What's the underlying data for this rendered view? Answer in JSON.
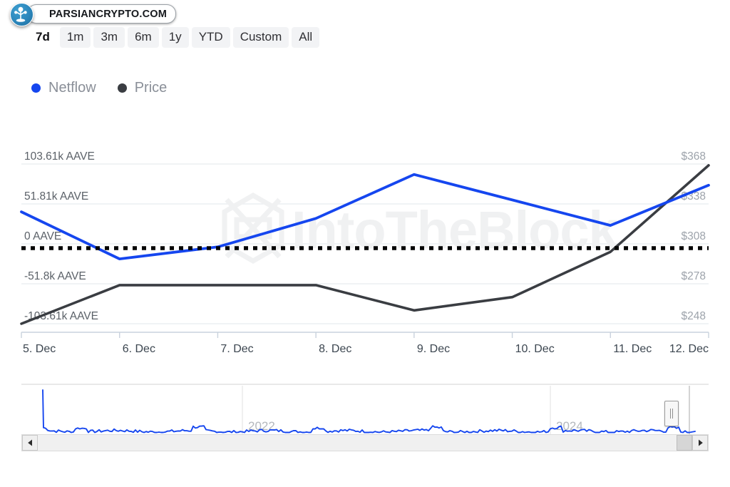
{
  "brand": {
    "watermark_label": "PARSIANCRYPTO.COM",
    "logo_icon": "parsiancrypto-circle-icon",
    "chart_watermark": "IntoTheBlock",
    "chart_watermark_icon": "intotheblock-cube-icon"
  },
  "range_tabs": {
    "items": [
      {
        "label": "7d",
        "selected": true
      },
      {
        "label": "1m",
        "selected": false
      },
      {
        "label": "3m",
        "selected": false
      },
      {
        "label": "6m",
        "selected": false
      },
      {
        "label": "1y",
        "selected": false
      },
      {
        "label": "YTD",
        "selected": false
      },
      {
        "label": "Custom",
        "selected": false
      },
      {
        "label": "All",
        "selected": false
      }
    ]
  },
  "legend": {
    "items": [
      {
        "label": "Netflow",
        "color": "#1546ef",
        "icon": "legend-dot-icon"
      },
      {
        "label": "Price",
        "color": "#3a3d42",
        "icon": "legend-dot-icon"
      }
    ]
  },
  "navigator": {
    "year_labels": [
      "2022",
      "2024"
    ],
    "left_arrow_icon": "triangle-left-icon",
    "right_arrow_icon": "triangle-right-icon",
    "handle_icon": "drag-handle-icon",
    "series_color": "#1546ef"
  },
  "chart_data": {
    "type": "line",
    "title": "",
    "subtitle": "",
    "xlabel": "",
    "grid": true,
    "legend_position": "top-left",
    "zero_line": {
      "value": 0,
      "style": "dotted",
      "color": "#000000"
    },
    "categories": [
      "5. Dec",
      "6. Dec",
      "7. Dec",
      "8. Dec",
      "9. Dec",
      "10. Dec",
      "11. Dec",
      "12. Dec"
    ],
    "x_tick_labels": [
      "5. Dec",
      "6. Dec",
      "7. Dec",
      "8. Dec",
      "9. Dec",
      "10. Dec",
      "11. Dec",
      "12. Dec"
    ],
    "axes": {
      "left": {
        "name": "Netflow",
        "unit": "AAVE",
        "tick_labels": [
          "103.61k AAVE",
          "51.81k AAVE",
          "0 AAVE",
          "-51.8k AAVE",
          "-103.61k AAVE"
        ],
        "tick_values": [
          103610,
          51810,
          0,
          -51800,
          -103610
        ],
        "ylim": [
          -103610,
          103610
        ]
      },
      "right": {
        "name": "Price",
        "unit": "USD",
        "tick_labels": [
          "$368",
          "$338",
          "$308",
          "$278",
          "$248"
        ],
        "tick_values": [
          368,
          338,
          308,
          278,
          248
        ],
        "ylim": [
          248,
          368
        ]
      }
    },
    "series": [
      {
        "name": "Netflow",
        "axis": "left",
        "color": "#1546ef",
        "unit": "AAVE",
        "values": [
          41500,
          -19500,
          -4000,
          33000,
          90000,
          57000,
          24000,
          76000
        ]
      },
      {
        "name": "Price",
        "axis": "right",
        "color": "#3a3d42",
        "unit": "USD",
        "values": [
          248,
          277,
          277,
          277,
          258,
          268,
          302,
          367
        ]
      }
    ]
  }
}
